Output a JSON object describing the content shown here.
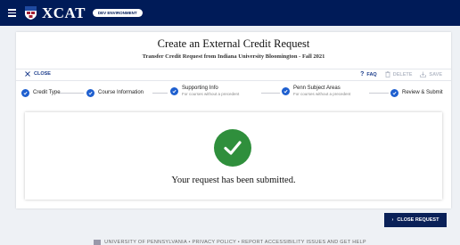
{
  "header": {
    "app_name": "XCAT",
    "env_badge": "DEV ENVIRONMENT"
  },
  "page": {
    "title": "Create an External Credit Request",
    "subtitle": "Transfer Credit Request from Indiana University Bloomington - Fall 2021"
  },
  "actions": {
    "close": "CLOSE",
    "faq": "FAQ",
    "delete": "DELETE",
    "save": "SAVE"
  },
  "steps": [
    {
      "label": "Credit Type",
      "sub": ""
    },
    {
      "label": "Course Information",
      "sub": ""
    },
    {
      "label": "Supporting Info",
      "sub": "For courses without a precedent"
    },
    {
      "label": "Penn Subject Areas",
      "sub": "For courses without a precedent"
    },
    {
      "label": "Review & Submit",
      "sub": ""
    }
  ],
  "confirmation": {
    "message": "Your request has been submitted."
  },
  "buttons": {
    "close_request": "CLOSE REQUEST"
  },
  "footer": {
    "text": "UNIVERSITY OF PENNSYLVANIA  •  PRIVACY POLICY  •  REPORT ACCESSIBILITY ISSUES AND GET HELP"
  },
  "colors": {
    "header_bg": "#001b58",
    "step_blue": "#1e5fcf",
    "success_green": "#2f8f3c",
    "button_navy": "#0a2158"
  }
}
